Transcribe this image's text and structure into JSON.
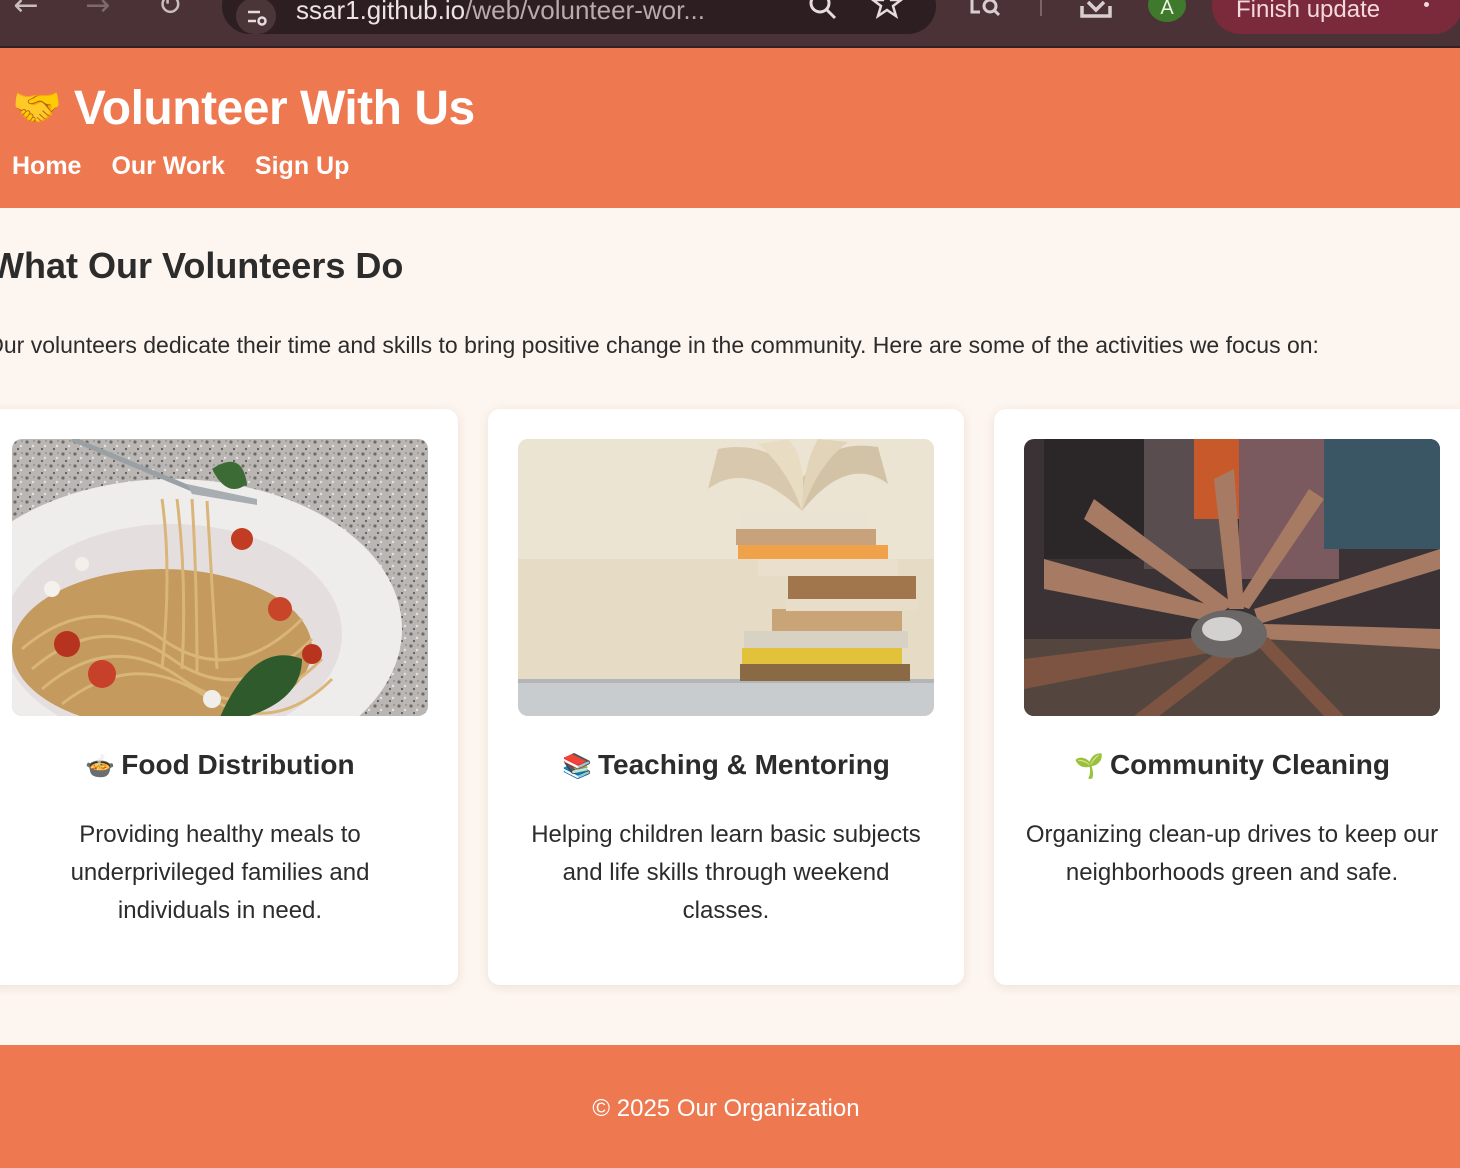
{
  "browser": {
    "url_main": "ssar1.github.io",
    "url_rest": "/web/volunteer-wor...",
    "avatar_letter": "A",
    "update_button_label": "Finish update"
  },
  "header": {
    "logo_emoji": "🤝",
    "title": "Volunteer With Us",
    "nav": [
      "Home",
      "Our Work",
      "Sign Up"
    ]
  },
  "main": {
    "title": "What Our Volunteers Do",
    "description": "Our volunteers dedicate their time and skills to bring positive change in the community. Here are some of the activities we focus on:",
    "cards": [
      {
        "emoji": "🍲",
        "title": "Food Distribution",
        "text": "Providing healthy meals to underprivileged families and individuals in need."
      },
      {
        "emoji": "📚",
        "title": "Teaching & Mentoring",
        "text": "Helping children learn basic subjects and life skills through weekend classes."
      },
      {
        "emoji": "🌱",
        "title": "Community Cleaning",
        "text": "Organizing clean-up drives to keep our neighborhoods green and safe."
      }
    ]
  },
  "footer": {
    "copyright": "© 2025 Our Organization"
  },
  "colors": {
    "brand": "#ee7850",
    "page_background": "#fdf5ef",
    "chrome_background": "#4a3236",
    "update_button": "#7a2a3a"
  }
}
